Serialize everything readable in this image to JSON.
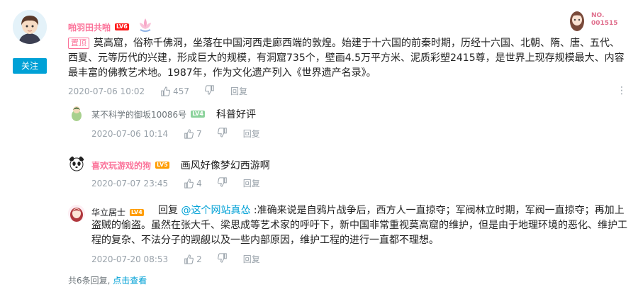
{
  "main": {
    "user_name": "啪羽田共啪",
    "level": "LV6",
    "follow_label": "关注",
    "pin_label": "置顶",
    "text": "莫高窟，俗称千佛洞，坐落在中国河西走廊西端的敦煌。始建于十六国的前秦时期，历经十六国、北朝、隋、唐、五代、西夏、元等历代的兴建，形成巨大的规模，有洞窟735个，壁画4.5万平方米、泥质彩塑2415尊，是世界上现存规模最大、内容最丰富的佛教艺术地。1987年，作为文化遗产列入《世界遗产名录》。",
    "time": "2020-07-06 10:02",
    "likes": "457",
    "reply_label": "回复",
    "nameplate_text": "NO.\n001515"
  },
  "replies": [
    {
      "user_name": "某不科学的御坂10086号",
      "level": "LV4",
      "text": "科普好评",
      "time": "2020-07-06 10:14",
      "likes": "7",
      "reply_label": "回复"
    },
    {
      "user_name": "喜欢玩游戏的狗",
      "level": "LV5",
      "text": "画风好像梦幻西游啊",
      "time": "2020-07-07 23:45",
      "likes": "4",
      "reply_label": "回复"
    },
    {
      "user_name": "华立居士",
      "level": "LV4",
      "reply_prefix": "回复 ",
      "mention": "@这个网站真怂",
      "text": " :准确来说是自鸦片战争后，西方人一直掠夺；军阀林立时期，军阀一直掠夺；再加上盗贼的偷盗。虽然在张大千、梁思成等艺术家的呼吁下，新中国非常重视莫高窟的维护，但是由于地理环境的恶化、维护工程的复杂、不法分子的觊觎以及一些内部原因，维护工程的进行一直都不理想。",
      "time": "2020-07-20 08:53",
      "likes": "2",
      "reply_label": "回复"
    }
  ],
  "footer": {
    "count_text": "共6条回复,",
    "view_link": "点击查看"
  },
  "colors": {
    "accent": "#00a1d6",
    "vip_pink": "#fb7299",
    "meta_gray": "#99a2aa"
  }
}
